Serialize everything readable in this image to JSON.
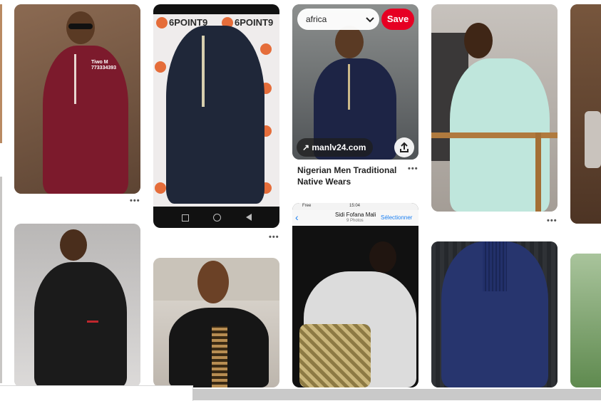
{
  "search": {
    "value": "africa",
    "save_label": "Save"
  },
  "pins": [
    {
      "id": "pin-1",
      "watermark": "Tiwo M\n773334393"
    },
    {
      "id": "pin-2",
      "watermark": "6POINT9"
    },
    {
      "id": "pin-3",
      "link_label": "manlv24.com",
      "title_line1": "Nigerian Men Traditional",
      "title_line2": "Native Wears"
    },
    {
      "id": "pin-4"
    },
    {
      "id": "pin-5"
    },
    {
      "id": "pin-6"
    },
    {
      "id": "pin-7",
      "status_time": "15:04",
      "status_carrier": "Free",
      "header_name": "Sidi Fofana Mali",
      "header_sub": "9 Photos",
      "header_select": "Sélectionner"
    },
    {
      "id": "pin-8"
    },
    {
      "id": "pin-9"
    }
  ],
  "more_label": "•••"
}
